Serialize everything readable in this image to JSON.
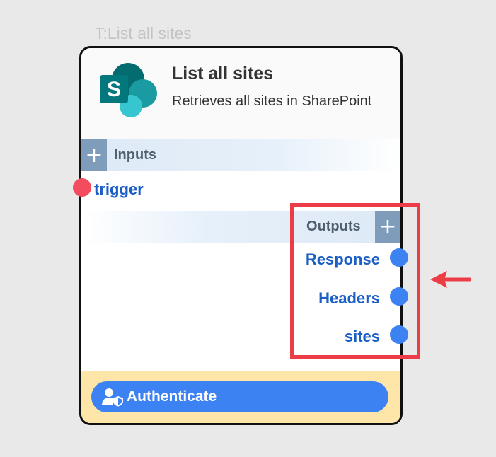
{
  "node_tag": "T:List all sites",
  "node": {
    "title": "List all sites",
    "description": "Retrieves all sites in SharePoint",
    "logo": "sharepoint-logo"
  },
  "inputs": {
    "section_label": "Inputs",
    "add_symbol": "+",
    "items": [
      {
        "label": "trigger",
        "port_color": "#f24c5e"
      }
    ]
  },
  "outputs": {
    "section_label": "Outputs",
    "add_symbol": "+",
    "items": [
      {
        "label": "Response",
        "port_color": "#3d82f2"
      },
      {
        "label": "Headers",
        "port_color": "#3d82f2"
      },
      {
        "label": "sites",
        "port_color": "#3d82f2"
      }
    ]
  },
  "auth": {
    "label": "Authenticate",
    "icon": "user-shield-icon"
  },
  "annotation": {
    "highlight_color": "#ec3d46",
    "arrow": "left-arrow-icon"
  },
  "colors": {
    "accent": "#3d82f2",
    "link_text": "#1b5fc4",
    "auth_background": "#fde6a8"
  }
}
